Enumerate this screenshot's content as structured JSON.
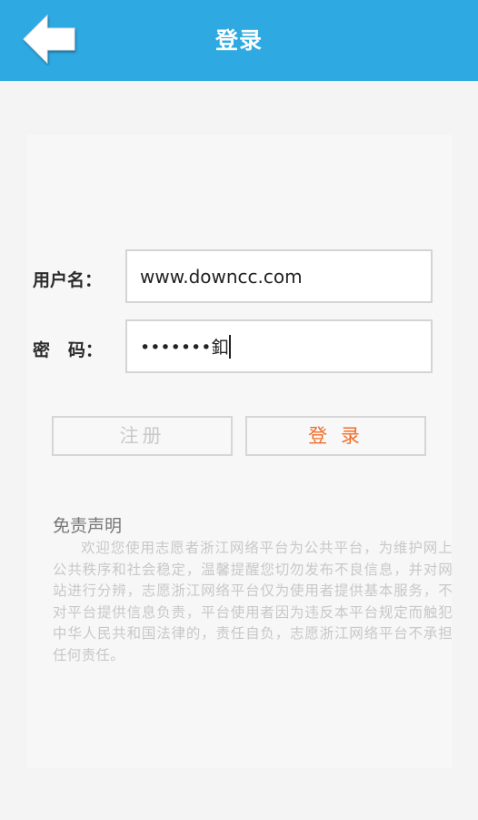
{
  "header": {
    "title": "登录",
    "back_icon": "back-arrow-icon",
    "color": "#2ea9e1"
  },
  "form": {
    "username_label": "用户名：",
    "username_value": "www.downcc.com",
    "password_label": "密   码：",
    "password_value": "•••••••釦"
  },
  "buttons": {
    "register_label": "注册",
    "login_label": "登 录",
    "login_color": "#ef6e2a",
    "register_color": "#c9c9c9"
  },
  "disclaimer": {
    "title": "免责声明",
    "body": "欢迎您使用志愿者浙江网络平台为公共平台，为维护网上公共秩序和社会稳定，温馨提醒您切勿发布不良信息，并对网站进行分辨，志愿浙江网络平台仅为使用者提供基本服务，不对平台提供信息负责，平台使用者因为违反本平台规定而触犯中华人民共和国法律的，责任自负，志愿浙江网络平台不承担任何责任。"
  }
}
